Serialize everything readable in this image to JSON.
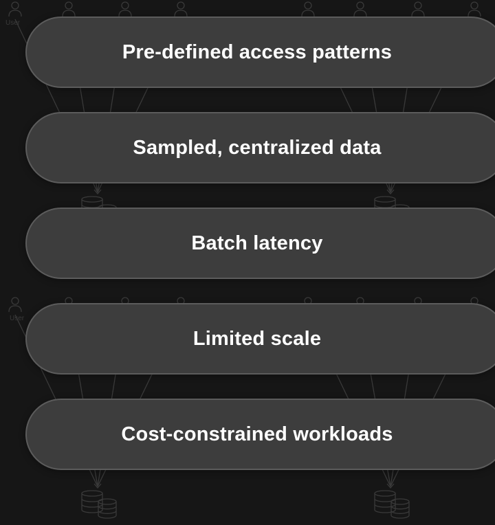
{
  "background": {
    "user_label": "User",
    "colors": {
      "page": "#161616",
      "figure_stroke": "#3a3a3a",
      "figure_stroke_faint": "#2c2c2c"
    }
  },
  "items": [
    {
      "label": "Pre-defined access patterns"
    },
    {
      "label": "Sampled, centralized data"
    },
    {
      "label": "Batch latency"
    },
    {
      "label": "Limited scale"
    },
    {
      "label": "Cost-constrained workloads"
    }
  ],
  "colors": {
    "pill_fill": "#3d3d3d",
    "pill_border": "#5c5c5c",
    "pill_text": "#ffffff"
  }
}
